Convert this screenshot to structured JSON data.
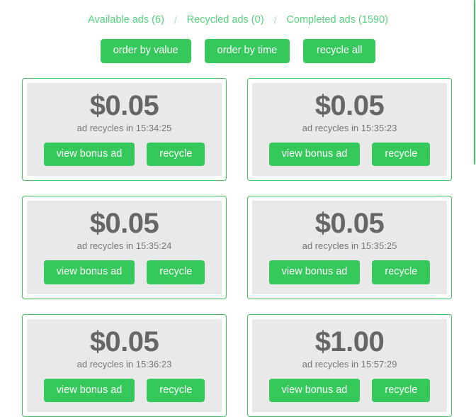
{
  "nav": {
    "separator": "/",
    "links": [
      {
        "label": "Available ads (6)",
        "name": "nav-available-ads"
      },
      {
        "label": "Recycled ads (0)",
        "name": "nav-recycled-ads"
      },
      {
        "label": "Completed ads (1590)",
        "name": "nav-completed-ads"
      }
    ]
  },
  "toolbar": {
    "order_by_value_label": "order by value",
    "order_by_time_label": "order by time",
    "recycle_all_label": "recycle all"
  },
  "card_actions": {
    "view_label": "view bonus ad",
    "recycle_label": "recycle"
  },
  "ads": [
    {
      "amount": "$0.05",
      "timer": "ad recycles in 15:34:25"
    },
    {
      "amount": "$0.05",
      "timer": "ad recycles in 15:35:23"
    },
    {
      "amount": "$0.05",
      "timer": "ad recycles in 15:35:24"
    },
    {
      "amount": "$0.05",
      "timer": "ad recycles in 15:35:25"
    },
    {
      "amount": "$0.05",
      "timer": "ad recycles in 15:36:23"
    },
    {
      "amount": "$1.00",
      "timer": "ad recycles in 15:57:29"
    }
  ],
  "colors": {
    "brand_green": "#35c95b",
    "border_green": "#3dc35f",
    "link_green": "#55d27e",
    "panel_gray": "#e9e9e9",
    "amount_gray": "#666666",
    "timer_gray": "#777777"
  }
}
